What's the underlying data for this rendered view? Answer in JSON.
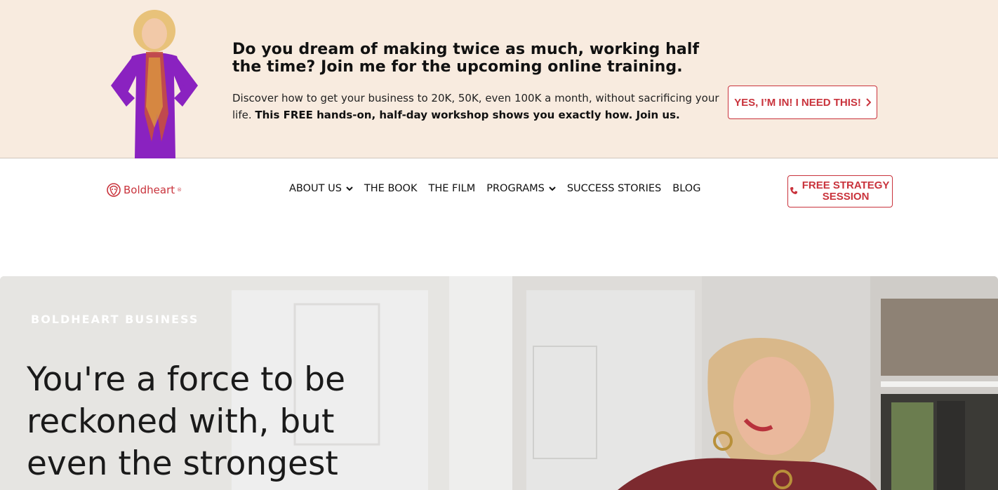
{
  "promo": {
    "headline": "Do you dream of making twice as much, working half the time? Join me for the upcoming online training.",
    "body_plain": "Discover how to get your business to 20K, 50K, even 100K a month, without sacrificing your life. ",
    "body_bold": "This FREE hands-on, half-day workshop shows you exactly how. Join us.",
    "button_label": "YES, I’M IN! I NEED THIS!",
    "button_icon": "chevron-right-icon"
  },
  "nav": {
    "logo_text": "Boldheart",
    "logo_mark": "®",
    "logo_icon": "lion-head-icon",
    "items": [
      {
        "label": "ABOUT US",
        "has_dropdown": true
      },
      {
        "label": "THE BOOK",
        "has_dropdown": false
      },
      {
        "label": "THE FILM",
        "has_dropdown": false
      },
      {
        "label": "PROGRAMS",
        "has_dropdown": true
      },
      {
        "label": "SUCCESS STORIES",
        "has_dropdown": false
      },
      {
        "label": "BLOG",
        "has_dropdown": false
      }
    ],
    "cta_label": "FREE STRATEGY SESSION",
    "cta_icon": "phone-icon"
  },
  "hero": {
    "kicker": "BOLDHEART BUSINESS",
    "title": "You're a force to be reckoned with, but even the strongest"
  },
  "colors": {
    "banner_bg": "#f8ebdf",
    "accent": "#c9333c",
    "hero_bg": "#d9d7d4"
  }
}
